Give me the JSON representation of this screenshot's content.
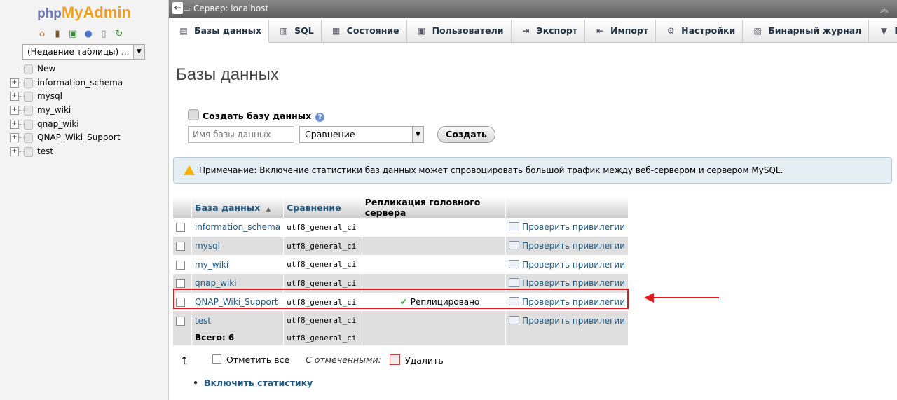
{
  "nav": {
    "logo_php": "php",
    "logo_admin": "MyAdmin",
    "recent_tables": "(Недавние таблицы) ...",
    "tree": [
      {
        "label": "New",
        "expandable": false
      },
      {
        "label": "information_schema",
        "expandable": true
      },
      {
        "label": "mysql",
        "expandable": true
      },
      {
        "label": "my_wiki",
        "expandable": true
      },
      {
        "label": "qnap_wiki",
        "expandable": true
      },
      {
        "label": "QNAP_Wiki_Support",
        "expandable": true
      },
      {
        "label": "test",
        "expandable": true
      }
    ]
  },
  "topbar": {
    "server": "Сервер: localhost"
  },
  "tabs": [
    {
      "label": "Базы данных",
      "icon": "database-icon",
      "active": true
    },
    {
      "label": "SQL",
      "icon": "sql-icon"
    },
    {
      "label": "Состояние",
      "icon": "status-icon"
    },
    {
      "label": "Пользователи",
      "icon": "users-icon"
    },
    {
      "label": "Экспорт",
      "icon": "export-icon"
    },
    {
      "label": "Импорт",
      "icon": "import-icon"
    },
    {
      "label": "Настройки",
      "icon": "wrench-icon"
    },
    {
      "label": "Бинарный журнал",
      "icon": "binlog-icon"
    },
    {
      "label": "Ещё",
      "icon": "chevron-down-icon"
    }
  ],
  "page": {
    "title": "Базы данных",
    "create_label": "Создать базу данных",
    "dbname_placeholder": "Имя базы данных",
    "collation_selected": "Сравнение",
    "create_button": "Создать",
    "notice": "Примечание: Включение статистики баз данных может спровоцировать большой трафик между веб-сервером и сервером MySQL."
  },
  "table": {
    "headers": {
      "database": "База данных",
      "sort_indicator": "▲",
      "collation": "Сравнение",
      "replication": "Репликация головного сервера"
    },
    "rows": [
      {
        "name": "information_schema",
        "collation": "utf8_general_ci",
        "replication": "",
        "action": "Проверить привилегии"
      },
      {
        "name": "mysql",
        "collation": "utf8_general_ci",
        "replication": "",
        "action": "Проверить привилегии"
      },
      {
        "name": "my_wiki",
        "collation": "utf8_general_ci",
        "replication": "",
        "action": "Проверить привилегии"
      },
      {
        "name": "qnap_wiki",
        "collation": "utf8_general_ci",
        "replication": "",
        "action": "Проверить привилегии"
      },
      {
        "name": "QNAP_Wiki_Support",
        "collation": "utf8_general_ci",
        "replication": "Реплицировано",
        "action": "Проверить привилегии"
      },
      {
        "name": "test",
        "collation": "utf8_general_ci",
        "replication": "",
        "action": "Проверить привилегии"
      }
    ],
    "total_label": "Всего: 6",
    "total_collation": "utf8_general_ci"
  },
  "bulk": {
    "select_all": "Отметить все",
    "with_selected": "С отмеченными:",
    "delete": "Удалить"
  },
  "stats_link": "Включить статистику",
  "colors": {
    "highlight": "#e31a22",
    "link": "#235a81"
  }
}
